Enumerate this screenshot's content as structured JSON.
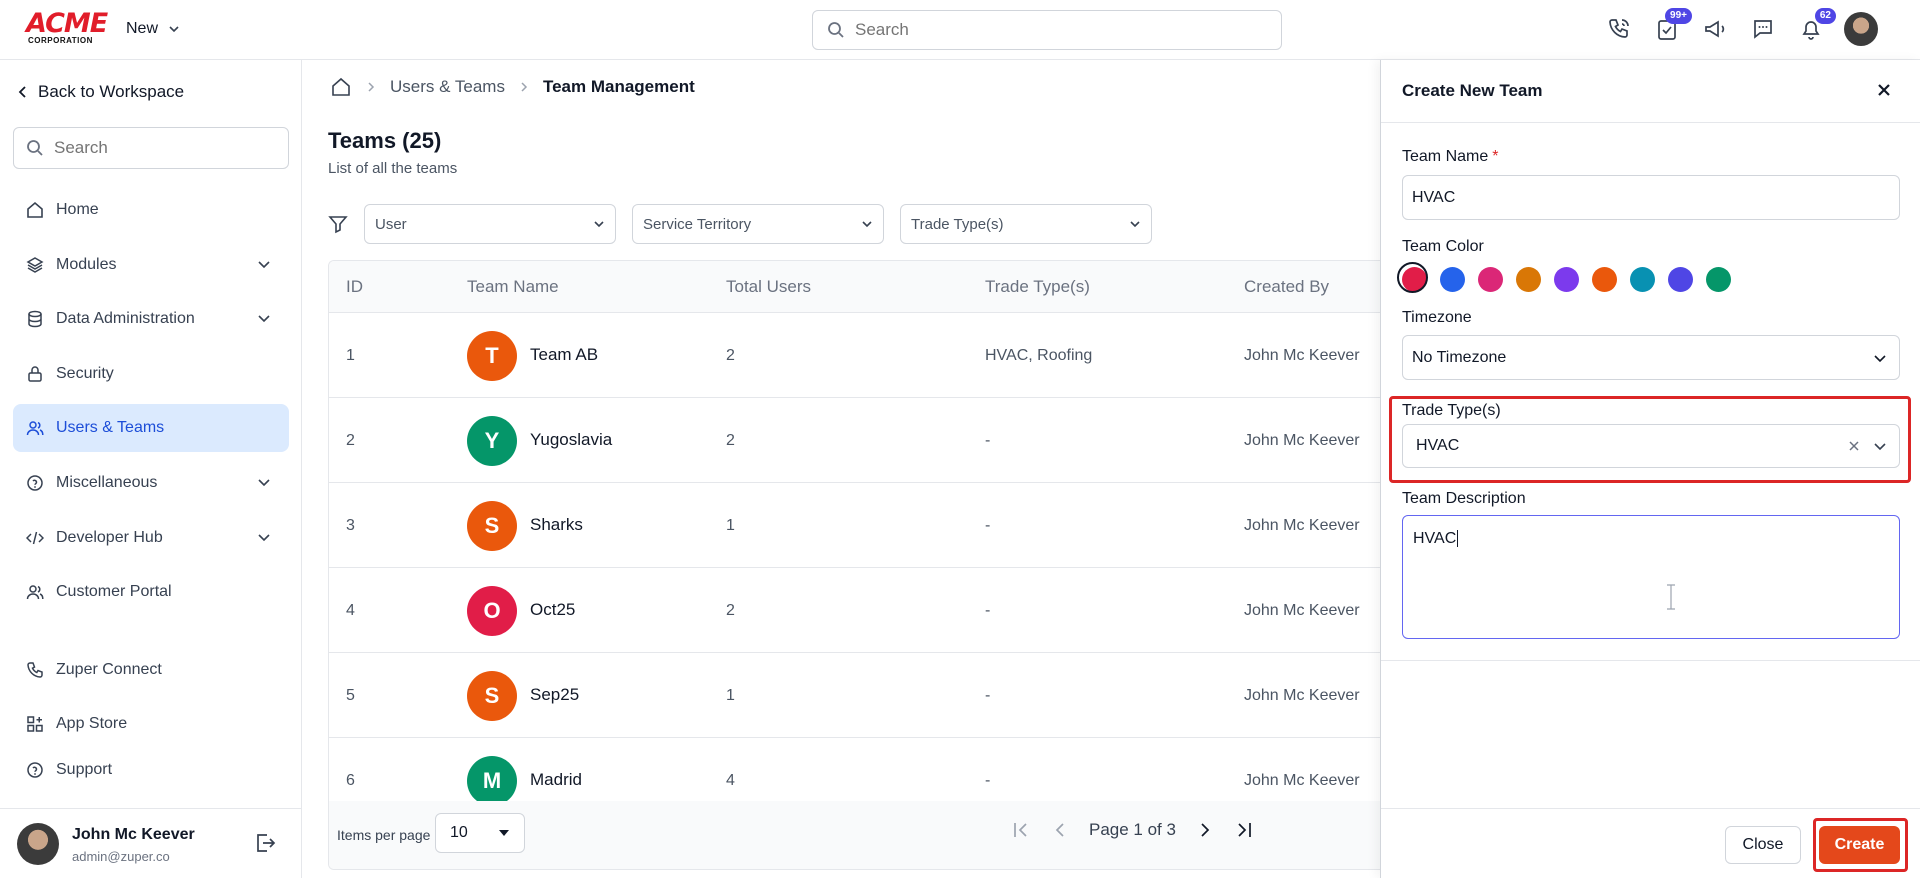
{
  "brand": {
    "logo_main": "ACME",
    "logo_sub": "CORPORATION"
  },
  "header": {
    "new_label": "New",
    "search_placeholder": "Search",
    "badges": {
      "tasks": "99+",
      "notifications": "62"
    }
  },
  "sidebar": {
    "back_label": "Back to Workspace",
    "search_placeholder": "Search",
    "items": [
      {
        "label": "Home",
        "icon": "home-icon"
      },
      {
        "label": "Modules",
        "icon": "layers-icon"
      },
      {
        "label": "Data Administration",
        "icon": "database-icon"
      },
      {
        "label": "Security",
        "icon": "lock-icon"
      },
      {
        "label": "Users & Teams",
        "icon": "users-icon",
        "active": true
      },
      {
        "label": "Miscellaneous",
        "icon": "help-circle-icon"
      },
      {
        "label": "Developer Hub",
        "icon": "code-icon"
      },
      {
        "label": "Customer Portal",
        "icon": "users-icon"
      },
      {
        "label": "Zuper Connect",
        "icon": "phone-icon"
      },
      {
        "label": "App Store",
        "icon": "apps-icon"
      },
      {
        "label": "Support",
        "icon": "help-circle-icon"
      }
    ],
    "user": {
      "name": "John Mc Keever",
      "email": "admin@zuper.co"
    }
  },
  "breadcrumb": {
    "parent": "Users & Teams",
    "current": "Team Management"
  },
  "page": {
    "title": "Teams (25)",
    "subtitle": "List of all the teams",
    "filters": {
      "user": "User",
      "territory": "Service Territory",
      "trade": "Trade Type(s)"
    }
  },
  "table": {
    "columns": {
      "id": "ID",
      "name": "Team Name",
      "users": "Total Users",
      "trade": "Trade Type(s)",
      "created_by": "Created By"
    },
    "rows": [
      {
        "id": "1",
        "initial": "T",
        "name": "Team AB",
        "users": "2",
        "trade": "HVAC, Roofing",
        "created_by": "John Mc Keever",
        "color": "#ea580c"
      },
      {
        "id": "2",
        "initial": "Y",
        "name": "Yugoslavia",
        "users": "2",
        "trade": "-",
        "created_by": "John Mc Keever",
        "color": "#059669"
      },
      {
        "id": "3",
        "initial": "S",
        "name": "Sharks",
        "users": "1",
        "trade": "-",
        "created_by": "John Mc Keever",
        "color": "#ea580c"
      },
      {
        "id": "4",
        "initial": "O",
        "name": "Oct25",
        "users": "2",
        "trade": "-",
        "created_by": "John Mc Keever",
        "color": "#e11d48"
      },
      {
        "id": "5",
        "initial": "S",
        "name": "Sep25",
        "users": "1",
        "trade": "-",
        "created_by": "John Mc Keever",
        "color": "#ea580c"
      },
      {
        "id": "6",
        "initial": "M",
        "name": "Madrid",
        "users": "4",
        "trade": "-",
        "created_by": "John Mc Keever",
        "color": "#059669"
      }
    ],
    "footer": {
      "items_per_page_label": "Items per page",
      "items_per_page": "10",
      "page_info": "Page 1 of 3"
    }
  },
  "drawer": {
    "title": "Create New Team",
    "team_name_label": "Team Name",
    "required_mark": "*",
    "team_name_value": "HVAC",
    "team_color_label": "Team Color",
    "colors": [
      "#e11d48",
      "#2563eb",
      "#db2777",
      "#d97706",
      "#7c3aed",
      "#ea580c",
      "#0891b2",
      "#4f46e5",
      "#059669"
    ],
    "selected_color": "#e11d48",
    "timezone_label": "Timezone",
    "timezone_value": "No Timezone",
    "trade_label": "Trade Type(s)",
    "trade_value": "HVAC",
    "description_label": "Team Description",
    "description_value": "HVAC",
    "close_label": "Close",
    "create_label": "Create"
  }
}
